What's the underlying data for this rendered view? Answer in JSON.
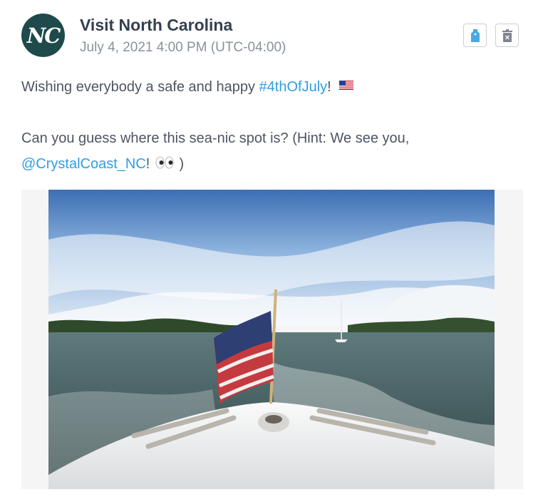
{
  "post": {
    "avatar_initials": "NC",
    "author": "Visit North Carolina",
    "timestamp": "July 4, 2021 4:00 PM (UTC-04:00)",
    "line1_prefix": "Wishing everybody a safe and happy ",
    "hashtag": "#4thOfJuly",
    "line1_suffix": "!",
    "line2": "Can you guess where this sea-nic spot is? (Hint: We see you,",
    "mention": "@CrystalCoast_NC",
    "line3_suffix": "!",
    "line3_close": ")"
  },
  "actions": {
    "tag_icon": "tag-icon",
    "delete_icon": "trash-icon"
  },
  "colors": {
    "link": "#2f9ee0",
    "avatar_bg": "#1f4a4c",
    "tag_blue": "#4aa8e0"
  },
  "media": {
    "icon": "photo-boat-flag"
  }
}
